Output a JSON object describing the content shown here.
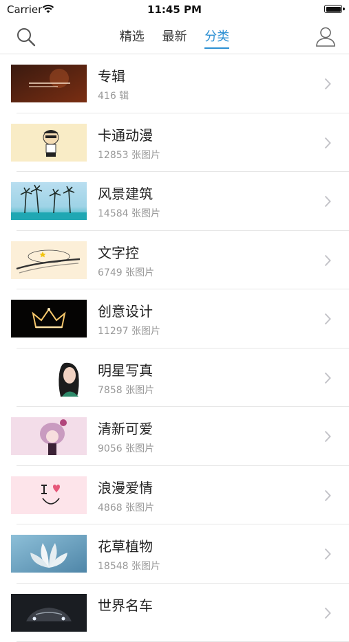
{
  "status_bar": {
    "carrier": "Carrier",
    "time": "11:45 PM"
  },
  "nav": {
    "tabs": [
      {
        "label": "精选",
        "active": false
      },
      {
        "label": "最新",
        "active": false
      },
      {
        "label": "分类",
        "active": true
      }
    ]
  },
  "categories": [
    {
      "title": "专辑",
      "count": "416 辑"
    },
    {
      "title": "卡通动漫",
      "count": "12853 张图片"
    },
    {
      "title": "风景建筑",
      "count": "14584 张图片"
    },
    {
      "title": "文字控",
      "count": "6749 张图片"
    },
    {
      "title": "创意设计",
      "count": "11297 张图片"
    },
    {
      "title": "明星写真",
      "count": "7858 张图片"
    },
    {
      "title": "清新可爱",
      "count": "9056 张图片"
    },
    {
      "title": "浪漫爱情",
      "count": "4868 张图片"
    },
    {
      "title": "花草植物",
      "count": "18548 张图片"
    },
    {
      "title": "世界名车",
      "count": ""
    }
  ],
  "accent_color": "#2b8fd3"
}
